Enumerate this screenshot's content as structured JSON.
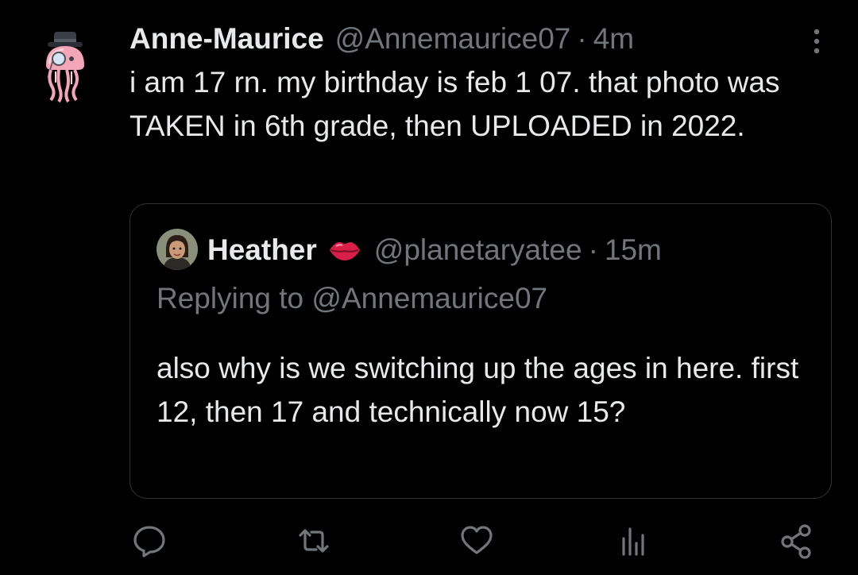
{
  "tweet": {
    "name": "Anne-Maurice",
    "handle": "@Annemaurice07",
    "separator": "·",
    "time": "4m",
    "text": "i am 17 rn. my birthday is feb 1 07. that photo was TAKEN in 6th grade, then UPLOADED in 2022.",
    "avatar_icon": "jellyfish-with-hat-avatar",
    "more_icon": "more-vertical-icon"
  },
  "quote": {
    "name": "Heather",
    "badge_icon": "lips-emoji",
    "handle": "@planetaryatee",
    "separator": "·",
    "time": "15m",
    "replying_prefix": "Replying to",
    "replying_to": "@Annemaurice07",
    "text": "also why is we switching up the ages in here. first 12, then 17 and technically now 15?"
  },
  "actions": [
    {
      "name": "reply",
      "icon": "reply-bubble-icon"
    },
    {
      "name": "retweet",
      "icon": "retweet-icon"
    },
    {
      "name": "like",
      "icon": "heart-icon"
    },
    {
      "name": "views",
      "icon": "views-bar-chart-icon"
    },
    {
      "name": "share",
      "icon": "share-icon"
    }
  ],
  "colors": {
    "background": "#000000",
    "text_primary": "#e7e9ea",
    "text_secondary": "#71767b",
    "border": "#2f3336",
    "lips": "#d91e48"
  }
}
